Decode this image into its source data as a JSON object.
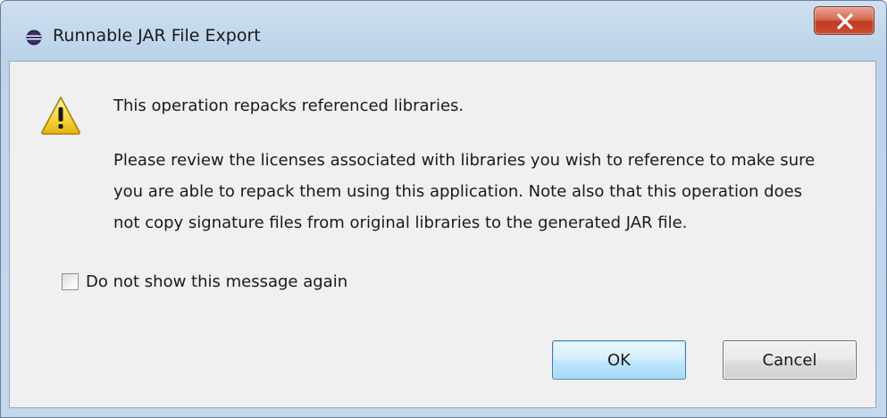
{
  "window": {
    "title": "Runnable JAR File Export",
    "icon": "eclipse-icon",
    "close_icon": "close-x-icon"
  },
  "message": {
    "icon": "warning-icon",
    "heading": "This operation repacks referenced libraries.",
    "body_lines": [
      "Please review the licenses associated with libraries you wish to reference to make sure",
      "you are able to repack them using this application. Note also that this operation does",
      "not copy signature files from original libraries to the generated JAR file."
    ]
  },
  "options": {
    "dont_show_label": "Do not show this message again",
    "dont_show_checked": false
  },
  "buttons": {
    "ok_label": "OK",
    "cancel_label": "Cancel"
  },
  "colors": {
    "close_button": "#c94c31",
    "ok_button_border": "#3c7fb1",
    "client_background": "#f0f0f0"
  }
}
